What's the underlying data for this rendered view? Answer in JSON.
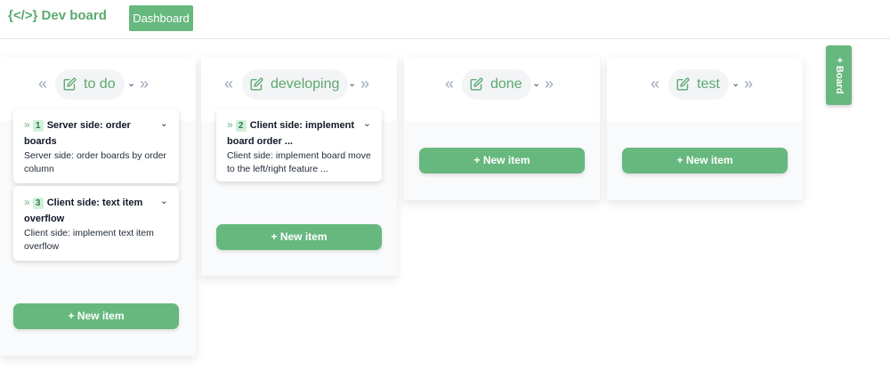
{
  "header": {
    "logo": "{</>} Dev board",
    "nav_button": "Dashboard"
  },
  "board_button": "+ Board",
  "colors": {
    "accent": "#67b87f",
    "title_text": "#5aa970",
    "card_number_bg": "#d1f0da"
  },
  "columns": [
    {
      "title": "to do",
      "prev_icon": "double-chevron-left-icon",
      "next_icon": "double-chevron-right-icon",
      "menu_icon": "chevron-down-icon",
      "edit_icon": "edit-icon",
      "new_item": "+ New item",
      "cards": [
        {
          "number": "1",
          "title": "Server side: order boards",
          "description": "Server side: order boards by order column"
        },
        {
          "number": "3",
          "title": "Client side: text item overflow",
          "description": "Client side: implement text item overflow"
        }
      ]
    },
    {
      "title": "developing",
      "prev_icon": "double-chevron-left-icon",
      "next_icon": "double-chevron-right-icon",
      "menu_icon": "chevron-down-icon",
      "edit_icon": "edit-icon",
      "new_item": "+ New item",
      "cards": [
        {
          "number": "2",
          "title": "Client side: implement board order ...",
          "description": "Client side: implement board move to the left/right feature ..."
        }
      ]
    },
    {
      "title": "done",
      "prev_icon": "double-chevron-left-icon",
      "next_icon": "double-chevron-right-icon",
      "menu_icon": "chevron-down-icon",
      "edit_icon": "edit-icon",
      "new_item": "+ New item",
      "cards": []
    },
    {
      "title": "test",
      "prev_icon": "double-chevron-left-icon",
      "next_icon": "double-chevron-right-icon",
      "menu_icon": "chevron-down-icon",
      "edit_icon": "edit-icon",
      "new_item": "+ New item",
      "cards": []
    }
  ]
}
